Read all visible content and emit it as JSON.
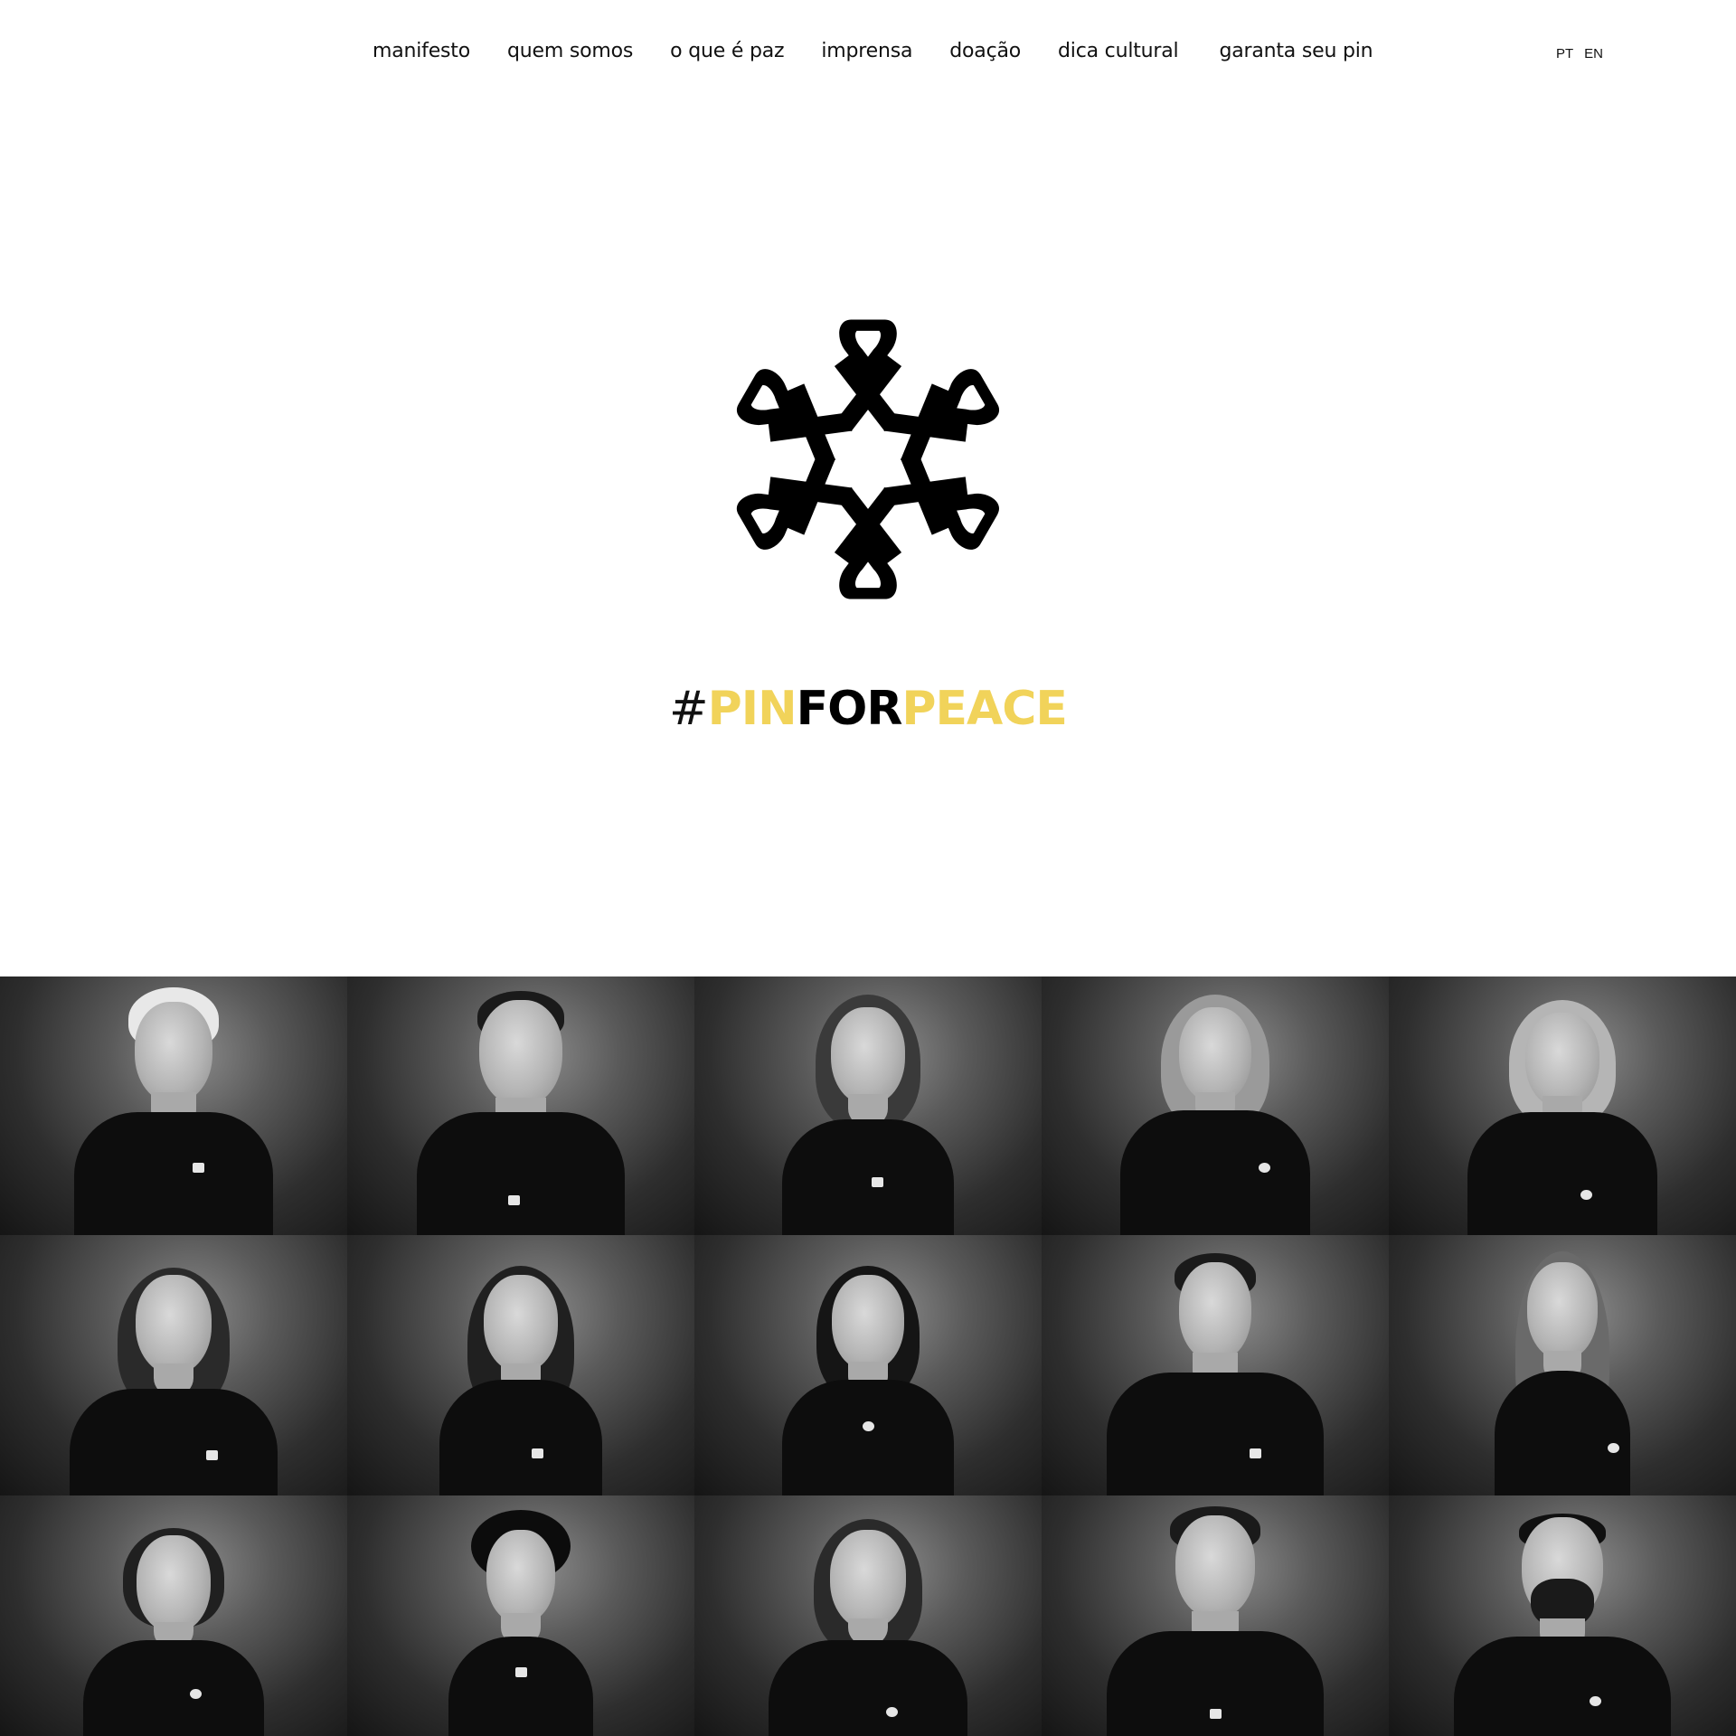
{
  "nav": {
    "links": [
      "manifesto",
      "quem somos",
      "o que é paz",
      "imprensa",
      "doação",
      "dica cultural",
      "garanta seu pin"
    ]
  },
  "lang": {
    "pt": "PT",
    "en": "EN"
  },
  "brand": {
    "emblem_icon": "six-ribbon-star-icon",
    "hashtag": {
      "hash": "#",
      "pin": "PIN",
      "for": "FOR",
      "peace": "PEACE"
    },
    "accent_color": "#f1d35a"
  },
  "gallery": {
    "rows": 3,
    "columns": 5,
    "count": 15,
    "style": "black-and-white portrait photos"
  }
}
